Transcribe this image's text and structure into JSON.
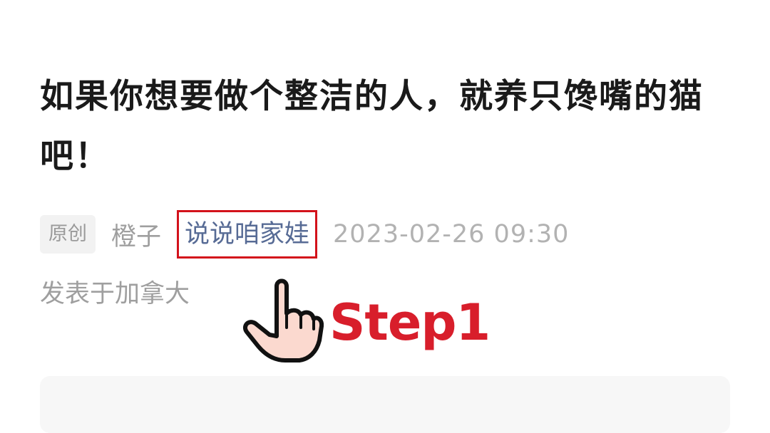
{
  "article": {
    "title": "如果你想要做个整洁的人，就养只馋嘴的猫吧！",
    "tag_original": "原创",
    "author": "橙子",
    "account_name": "说说咱家娃",
    "datetime": "2023-02-26 09:30",
    "location": "发表于加拿大"
  },
  "overlay": {
    "step_label": "Step1",
    "pointer_icon": "hand-pointer-icon",
    "highlight_color": "#d3121b"
  },
  "colors": {
    "title": "#1a1a1a",
    "link": "#576b95",
    "meta": "#9f9f9f",
    "step": "#d81e2b"
  }
}
